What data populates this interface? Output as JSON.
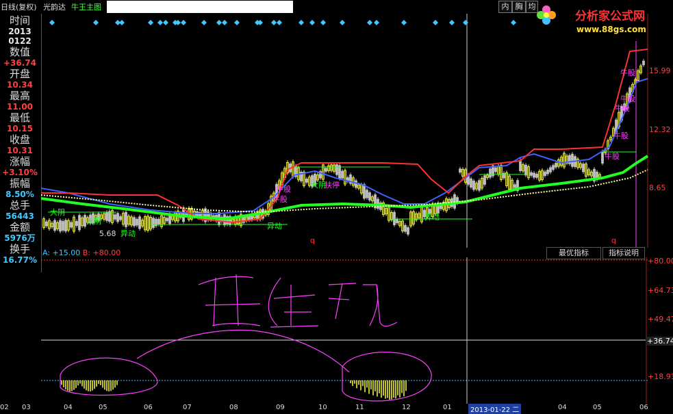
{
  "toolbar": {
    "period_label": "日线(复权)",
    "stock_name": "光韵达",
    "indicator_name": "牛王主图",
    "btn_nei": "内",
    "btn_xiong": "胸",
    "btn_jun": "均"
  },
  "logo": {
    "brand": "分析家公式网",
    "url": "www.88gs.com"
  },
  "info_panel": [
    {
      "label": "时间",
      "value": "2013",
      "value2": "0122",
      "color": "#e8e8e8"
    },
    {
      "label": "数值",
      "value": "+36.74",
      "color": "#ff4040"
    },
    {
      "label": "开盘",
      "value": "10.34",
      "color": "#ff4040"
    },
    {
      "label": "最高",
      "value": "11.00",
      "color": "#ff4040"
    },
    {
      "label": "最低",
      "value": "10.15",
      "color": "#ff4040"
    },
    {
      "label": "收盘",
      "value": "10.31",
      "color": "#ff4040"
    },
    {
      "label": "涨幅",
      "value": "+3.10%",
      "color": "#ff4040"
    },
    {
      "label": "振幅",
      "value": "8.50%",
      "color": "#40c8ff"
    },
    {
      "label": "总手",
      "value": "56443",
      "color": "#40c8ff"
    },
    {
      "label": "金额",
      "value": "5976万",
      "color": "#40c8ff"
    },
    {
      "label": "换手",
      "value": "16.77%",
      "color": "#40c8ff"
    }
  ],
  "price_axis": [
    "15.99",
    "12.32",
    "8.65"
  ],
  "chart_labels": {
    "da_yin_1": "大阴",
    "da_yin_2": "大阴",
    "low_value": "5.68",
    "yidong_1": "异动",
    "yidong_2": "异动",
    "yidong_3": "异动",
    "niugu_1": "牛股",
    "niugu_2": "牛股",
    "niugu_3": "牛股",
    "niugu_4": "牛股",
    "niugu_5": "牛股",
    "niugu_6": "牛股",
    "niugu_7": "牛股",
    "dayin_fuiting": "大阴",
    "fuiting": "扶停",
    "q_1": "q",
    "q_2": "q"
  },
  "indicator": {
    "a_label": "A:",
    "a_value": "+15.00",
    "b_label": "B:",
    "b_value": "+80.00",
    "btn_best": "最优指标",
    "btn_explain": "指标说明",
    "axis": [
      "+80.00",
      "+64.73",
      "+49.47",
      "+36.74",
      "+18.93"
    ],
    "handwriting": "黄金坑"
  },
  "x_axis": [
    "02",
    "03",
    "04",
    "05",
    "06",
    "07",
    "08",
    "09",
    "10",
    "11",
    "12",
    "01",
    "2013-01-22 二",
    "04",
    "05",
    "06"
  ],
  "colors": {
    "red": "#ff3030",
    "blue": "#4060ff",
    "green": "#20ff20",
    "yellow": "#ffff40",
    "magenta": "#ff40ff",
    "cyan": "#40c8ff"
  }
}
